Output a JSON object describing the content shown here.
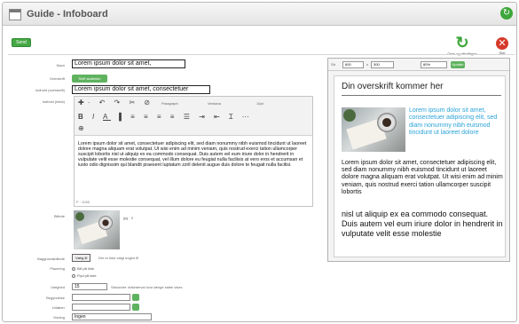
{
  "window": {
    "title": "Guide - Infoboard"
  },
  "toolbar": {
    "send_label": "Send",
    "save_label": "Gem og afkvittigen",
    "close_label": "Slet"
  },
  "form": {
    "navn_label": "Navn",
    "navn_value": "Lorem ipsum dolor sit amet,",
    "overskrift_label": "Overskrift",
    "pill_label": "Skift skabelon",
    "indhold_label": "Indhold (overskrift)",
    "indhold_value": "Lorem ipsum dolor sit amet, consectetuer",
    "tekst_label": "Indhold (tekst)",
    "billede_label": "Billede",
    "billede_meta": "jpg · 0",
    "baggrund_label": "Baggrundsbillede",
    "baggrund_button": "Vælg fil",
    "baggrund_note": "Der er ikke valgt nogen fil",
    "placering_label": "Placering",
    "radio_1": "Bill på linie",
    "radio_2": "Flyd på side",
    "varighed_label": "Varighed",
    "varighed_value": "15",
    "varighed_note": "Sekunder: tidsinterval hvor længe siden vises",
    "start_label": "Begyndelse",
    "slut_label": "Udløber",
    "visning_label": "Visning",
    "visning_value": "Ingen"
  },
  "editor": {
    "paragraph_label": "Paragraph",
    "font_label": "Verdana",
    "size_label": "10pt",
    "body": "Lorem ipsum dolor sit amet, consectetuer adipiscing elit, sed diam nonummy nibh euismod tincidunt ut laoreet dolore magna aliquam erat volutpat. Ut wisi enim ad minim veniam, quis nostrud exerci tation ullamcorper suscipit lobortis nisl ut aliquip ex ea commodo consequat. Duis autem vel eum iriure dolor in hendrerit in vulputate velit esse molestie consequat, vel illum dolore eu feugiat nulla facilisis at vero eros et accumsan et iusto odio dignissim qui blandit praesent luptatum zzril delenit augue duis dolore te feugait nulla facilisi.",
    "status": "P · 1000"
  },
  "preview": {
    "toolbar": {
      "size_label": "Str",
      "width_value": "600",
      "x_label": "x",
      "height_value": "300",
      "zoom_value": "80%",
      "update_button": "Update"
    },
    "title": "Din overskrift kommer her",
    "highlight": "Lorem ipsum dolor sit amet, consectetuer adipiscing elit, sed diam nonummy nibh euismod tincidunt ut laoreet dolore",
    "body": "Lorem ipsum dolor sit amet, consectetuer adipiscing elit, sed diam nonummy nibh euismod tincidunt ut laoreet dolore magna aliquam erat volutpat. Ut wisi enim ad minim veniam, quis nostrud exerci tation ullamcorper suscipit lobortis",
    "body_large": "nisl ut aliquip ex ea commodo consequat. Duis autem vel eum iriure dolor in hendrerit in vulputate velit esse molestie"
  },
  "colors": {
    "accent_green": "#3ea63a",
    "close_red": "#d63a2a",
    "preview_link": "#2aa3d8"
  }
}
